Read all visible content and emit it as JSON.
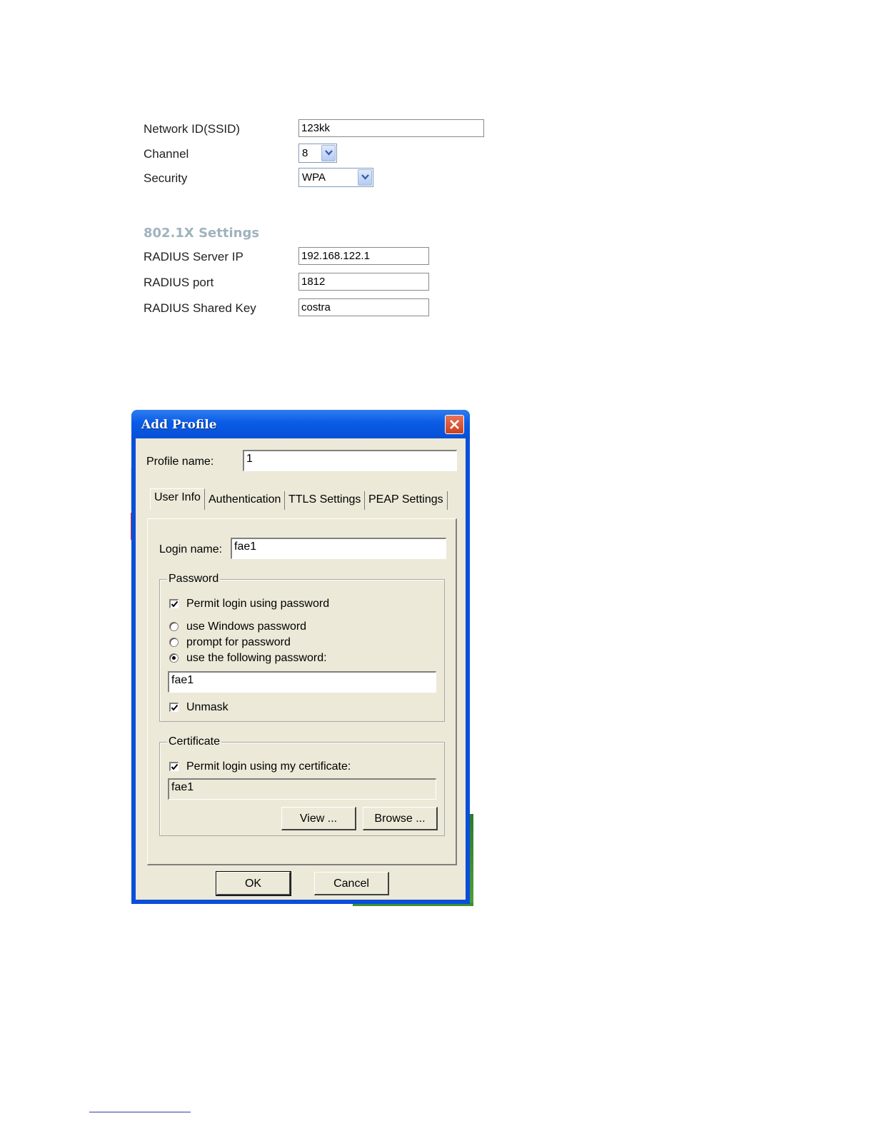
{
  "wireless_settings": {
    "ssid_label": "Network ID(SSID)",
    "ssid_value": "123kk",
    "channel_label": "Channel",
    "channel_value": "8",
    "security_label": "Security",
    "security_value": "WPA"
  },
  "dot1x_settings": {
    "heading": "802.1X Settings",
    "radius_ip_label": "RADIUS Server IP",
    "radius_ip_value": "192.168.122.1",
    "radius_port_label": "RADIUS port",
    "radius_port_value": "1812",
    "radius_key_label": "RADIUS Shared Key",
    "radius_key_value": "costra"
  },
  "dialog": {
    "title": "Add Profile",
    "profile_name_label": "Profile name:",
    "profile_name_value": "1",
    "tabs": [
      {
        "label": "User Info",
        "active": true
      },
      {
        "label": "Authentication",
        "active": false
      },
      {
        "label": "TTLS Settings",
        "active": false
      },
      {
        "label": "PEAP Settings",
        "active": false
      }
    ],
    "user_info": {
      "login_name_label": "Login name:",
      "login_name_value": "fae1",
      "password_group": {
        "title": "Password",
        "permit_password_label": "Permit login using password",
        "permit_password_checked": true,
        "windows_password_label": "use Windows password",
        "prompt_password_label": "prompt for password",
        "following_password_label": "use the following password:",
        "selected_option": "use the following password",
        "password_value": "fae1",
        "unmask_label": "Unmask",
        "unmask_checked": true
      },
      "certificate_group": {
        "title": "Certificate",
        "permit_certificate_label": "Permit login using my certificate:",
        "permit_certificate_checked": true,
        "certificate_value": "fae1",
        "view_button": "View ...",
        "browse_button": "Browse ..."
      }
    },
    "ok_button": "OK",
    "cancel_button": "Cancel"
  },
  "icons": {
    "close": "close-icon",
    "dropdown": "chevron-down-icon",
    "check": "checkmark-icon"
  },
  "colors": {
    "titlebar": "#0a5ce6",
    "dialog_face": "#ece9d8",
    "section_heading": "#9fb3be",
    "close_button": "#d1502c"
  }
}
